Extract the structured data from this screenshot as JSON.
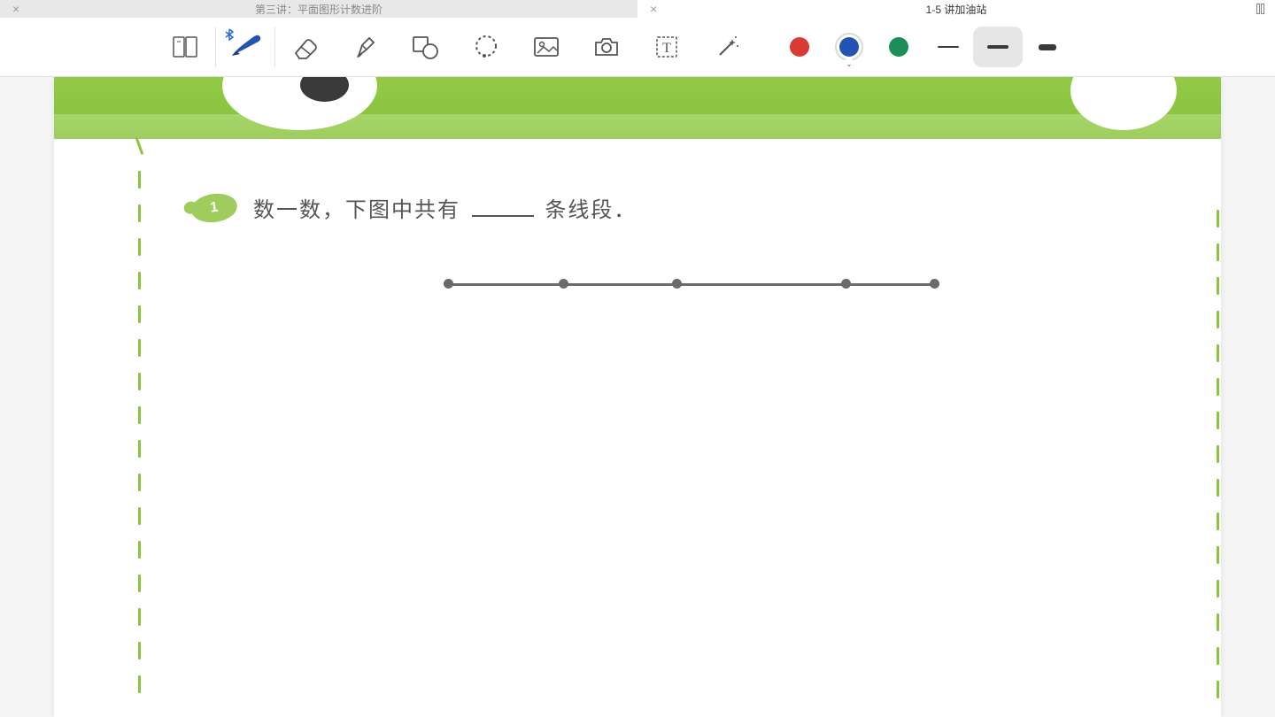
{
  "tabs": [
    {
      "title": "第三讲：平面图形计数进阶",
      "active": false
    },
    {
      "title": "1-5 讲加油站",
      "active": true
    }
  ],
  "toolbar": {
    "colors": {
      "red": "#d83a34",
      "blue": "#2354b4",
      "green": "#1d8e5a"
    },
    "selected_color": "blue",
    "selected_stroke": "medium"
  },
  "content": {
    "question_number": "1",
    "question_prefix": "数一数，下图中共有",
    "question_suffix": "条线段．",
    "line_points": [
      0,
      130,
      258,
      449,
      549
    ]
  }
}
